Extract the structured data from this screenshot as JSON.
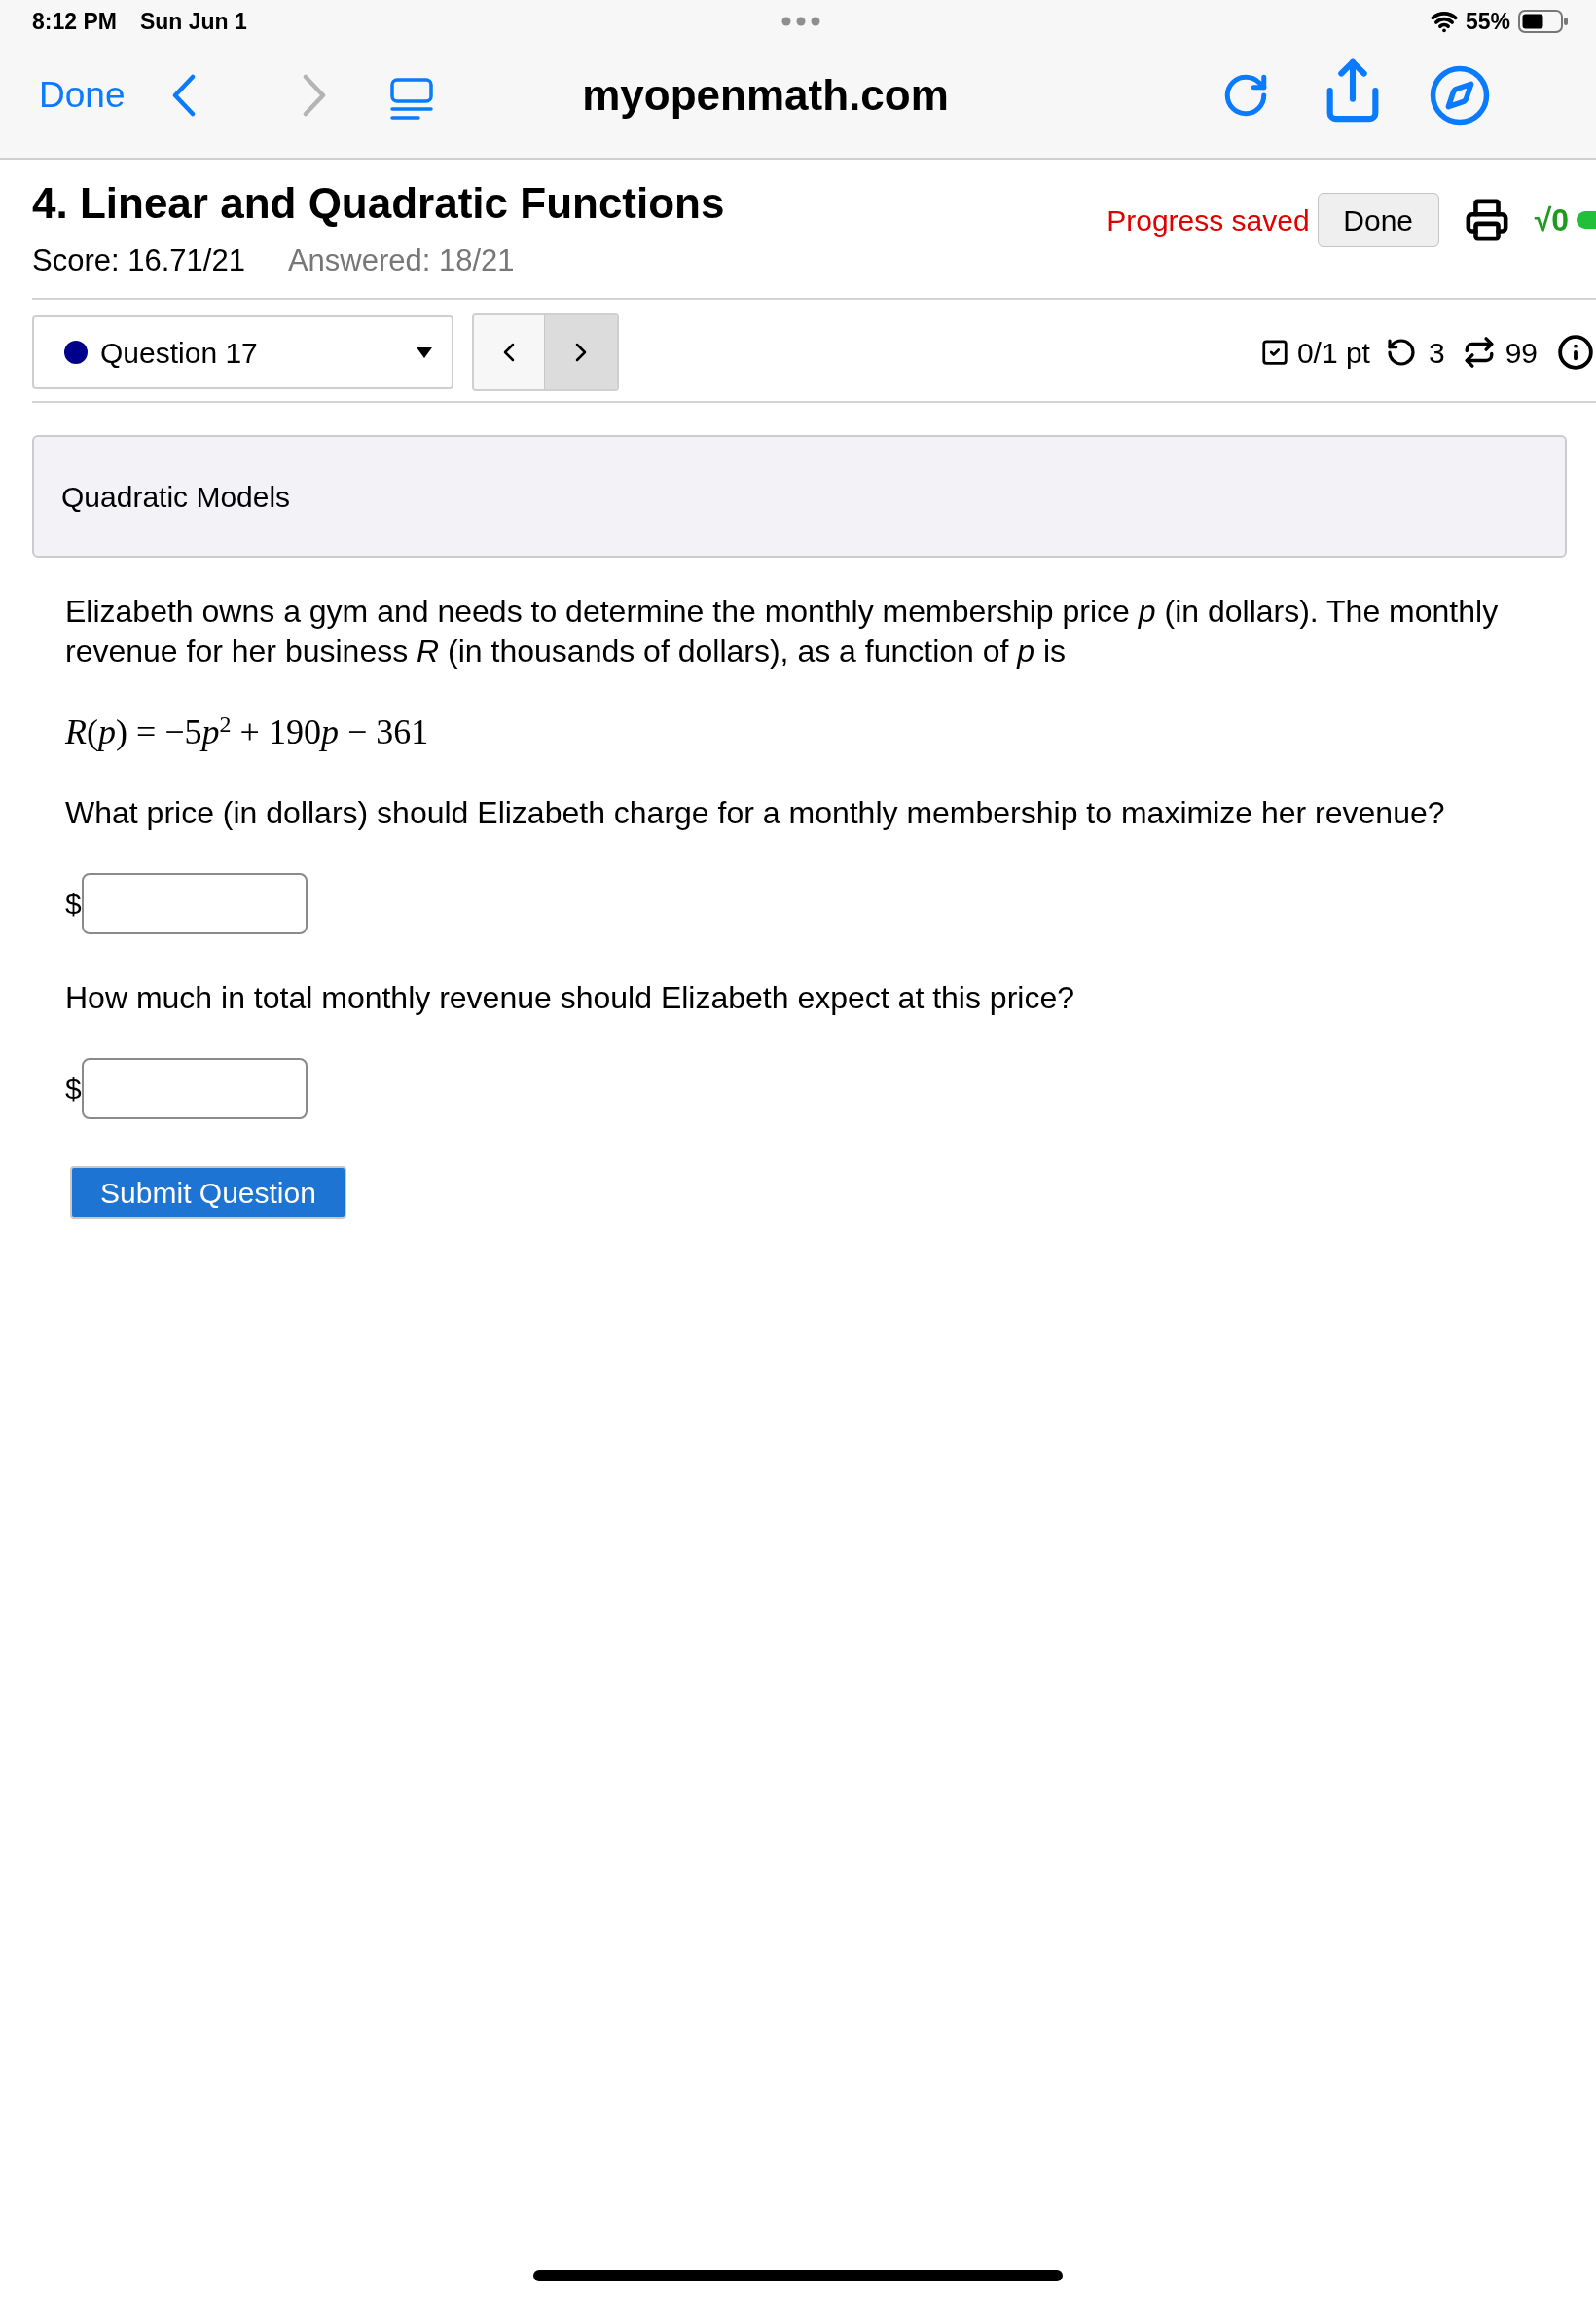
{
  "status_bar": {
    "time": "8:12 PM",
    "date": "Sun Jun 1",
    "battery": "55%"
  },
  "browser": {
    "done": "Done",
    "nav": [
      {
        "kind": "back",
        "disabled": false
      },
      {
        "kind": "forward",
        "disabled": true
      }
    ],
    "url": "myopenmath.com"
  },
  "assessment": {
    "title": "4. Linear and Quadratic Functions",
    "score": "Score: 16.71/21",
    "answered": "Answered: 18/21",
    "save_status": "Progress saved",
    "done": "Done",
    "math_toggle": {
      "label": "√0",
      "on": true
    }
  },
  "question_nav": {
    "question": {
      "label": "Question 17",
      "color": "#00008b"
    },
    "pager": [
      {
        "kind": "prev",
        "pressed": false
      },
      {
        "kind": "next",
        "pressed": true
      }
    ],
    "points": "0/1 pt",
    "tries": "3",
    "versions": "99"
  },
  "question": {
    "title": "Quadratic Models",
    "intro": "Elizabeth owns a gym and needs to determine the monthly membership price *p* (in dollars). The monthly revenue for her business *R* (in thousands of dollars), as a function of *p* is",
    "equation": [
      {
        "kind": "var",
        "text": "R"
      },
      {
        "kind": "plain",
        "text": "("
      },
      {
        "kind": "var",
        "text": "p"
      },
      {
        "kind": "plain",
        "text": ") = −5"
      },
      {
        "kind": "var",
        "text": "p"
      },
      {
        "kind": "sup",
        "text": "2"
      },
      {
        "kind": "plain",
        "text": " + 190"
      },
      {
        "kind": "var",
        "text": "p"
      },
      {
        "kind": "plain",
        "text": " − 361"
      }
    ],
    "parts": [
      {
        "prompt": "What price (in dollars) should Elizabeth charge for a monthly membership to maximize her revenue?",
        "prefix": "$"
      },
      {
        "prompt": "How much in total monthly revenue should Elizabeth expect at this price?",
        "prefix": "$"
      }
    ],
    "submit": "Submit Question"
  }
}
